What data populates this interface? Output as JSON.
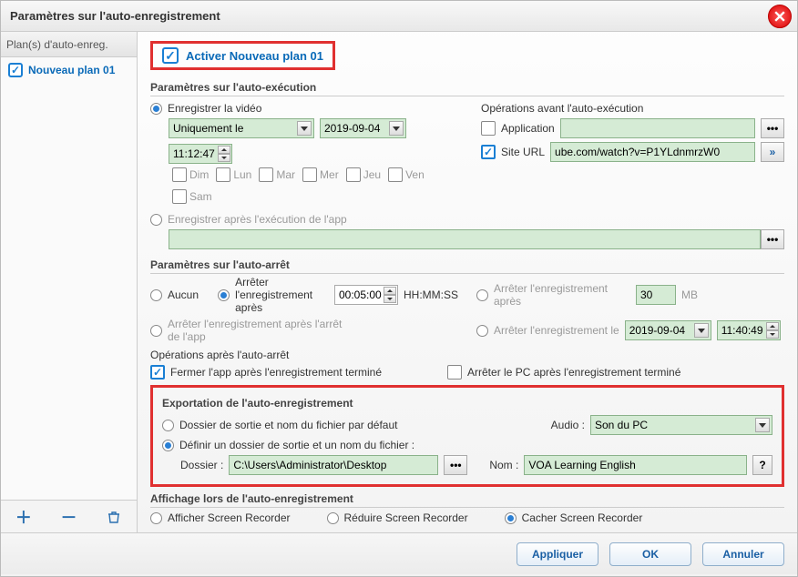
{
  "window": {
    "title": "Paramètres sur l'auto-enregistrement"
  },
  "sidebar": {
    "header": "Plan(s) d'auto-enreg.",
    "items": [
      {
        "label": "Nouveau plan 01",
        "checked": true
      }
    ]
  },
  "activate": {
    "label": "Activer Nouveau plan 01"
  },
  "autoexec": {
    "title": "Paramètres sur l'auto-exécution",
    "record_video": "Enregistrer la vidéo",
    "mode_value": "Uniquement le",
    "date_value": "2019-09-04",
    "time_value": "11:12:47",
    "days": {
      "dim": "Dim",
      "lun": "Lun",
      "mar": "Mar",
      "mer": "Mer",
      "jeu": "Jeu",
      "ven": "Ven",
      "sam": "Sam"
    },
    "record_after_app": "Enregistrer après l'exécution de l'app",
    "ops_before": "Opérations avant l'auto-exécution",
    "application": "Application",
    "site_url": "Site URL",
    "url_value": "ube.com/watch?v=P1YLdnmrzW0"
  },
  "autostop": {
    "title": "Paramètres sur l'auto-arrêt",
    "none": "Aucun",
    "stop_after": "Arrêter l'enregistrement après",
    "duration_value": "00:05:00",
    "duration_format": "HH:MM:SS",
    "stop_after_size": "Arrêter l'enregistrement après",
    "size_value": "30",
    "size_unit": "MB",
    "stop_after_app_close": "Arrêter l'enregistrement après l'arrêt de l'app",
    "stop_at": "Arrêter l'enregistrement le",
    "stop_date": "2019-09-04",
    "stop_time": "11:40:49",
    "ops_after": "Opérations après l'auto-arrêt",
    "close_app_after": "Fermer l'app après l'enregistrement terminé",
    "shutdown_after": "Arrêter le PC après l'enregistrement terminé"
  },
  "export": {
    "title": "Exportation de l'auto-enregistrement",
    "default_folder": "Dossier de sortie et nom du fichier par défaut",
    "define_folder": "Définir un dossier de sortie et un nom du fichier :",
    "folder_label": "Dossier :",
    "folder_value": "C:\\Users\\Administrator\\Desktop",
    "audio_label": "Audio :",
    "audio_value": "Son du PC",
    "name_label": "Nom :",
    "name_value": "VOA Learning English"
  },
  "display": {
    "title": "Affichage lors de l'auto-enregistrement",
    "show": "Afficher Screen Recorder",
    "reduce": "Réduire Screen Recorder",
    "hide": "Cacher Screen Recorder"
  },
  "buttons": {
    "apply": "Appliquer",
    "ok": "OK",
    "cancel": "Annuler"
  }
}
